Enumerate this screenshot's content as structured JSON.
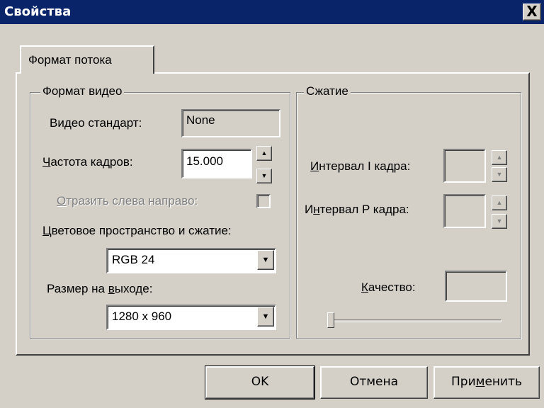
{
  "window": {
    "title": "Свойства",
    "close_glyph": "X"
  },
  "tab": {
    "label": "Формат потока"
  },
  "video_format": {
    "group_title": "Формат видео",
    "standard_label": "Видео стандарт:",
    "standard_value": "None",
    "fps_label_u": "Ч",
    "fps_label_rest": "астота кадров:",
    "fps_value": "15.000",
    "mirror_label_u": "О",
    "mirror_label_rest": "тразить слева направо:",
    "mirror_checked": false,
    "colorspace_label_u": "Ц",
    "colorspace_label_rest": "ветовое пространство и сжатие:",
    "colorspace_value": "RGB 24",
    "output_size_label_pre": "Размер на ",
    "output_size_label_u": "в",
    "output_size_label_post": "ыходе:",
    "output_size_value": "1280 x 960"
  },
  "compression": {
    "group_title": "Сжатие",
    "i_interval_label_u": "И",
    "i_interval_label_rest": "нтервал I кадра:",
    "p_interval_label_pre": "И",
    "p_interval_label_u": "н",
    "p_interval_label_post": "тервал P кадра:",
    "quality_label_u": "К",
    "quality_label_rest": "ачество:",
    "quality_level": 0
  },
  "buttons": {
    "ok": "OK",
    "cancel": "Отмена",
    "apply_pre": "При",
    "apply_u": "м",
    "apply_post": "енить"
  },
  "icons": {
    "up_arrow": "▲",
    "down_arrow": "▼",
    "close": "close-icon"
  }
}
